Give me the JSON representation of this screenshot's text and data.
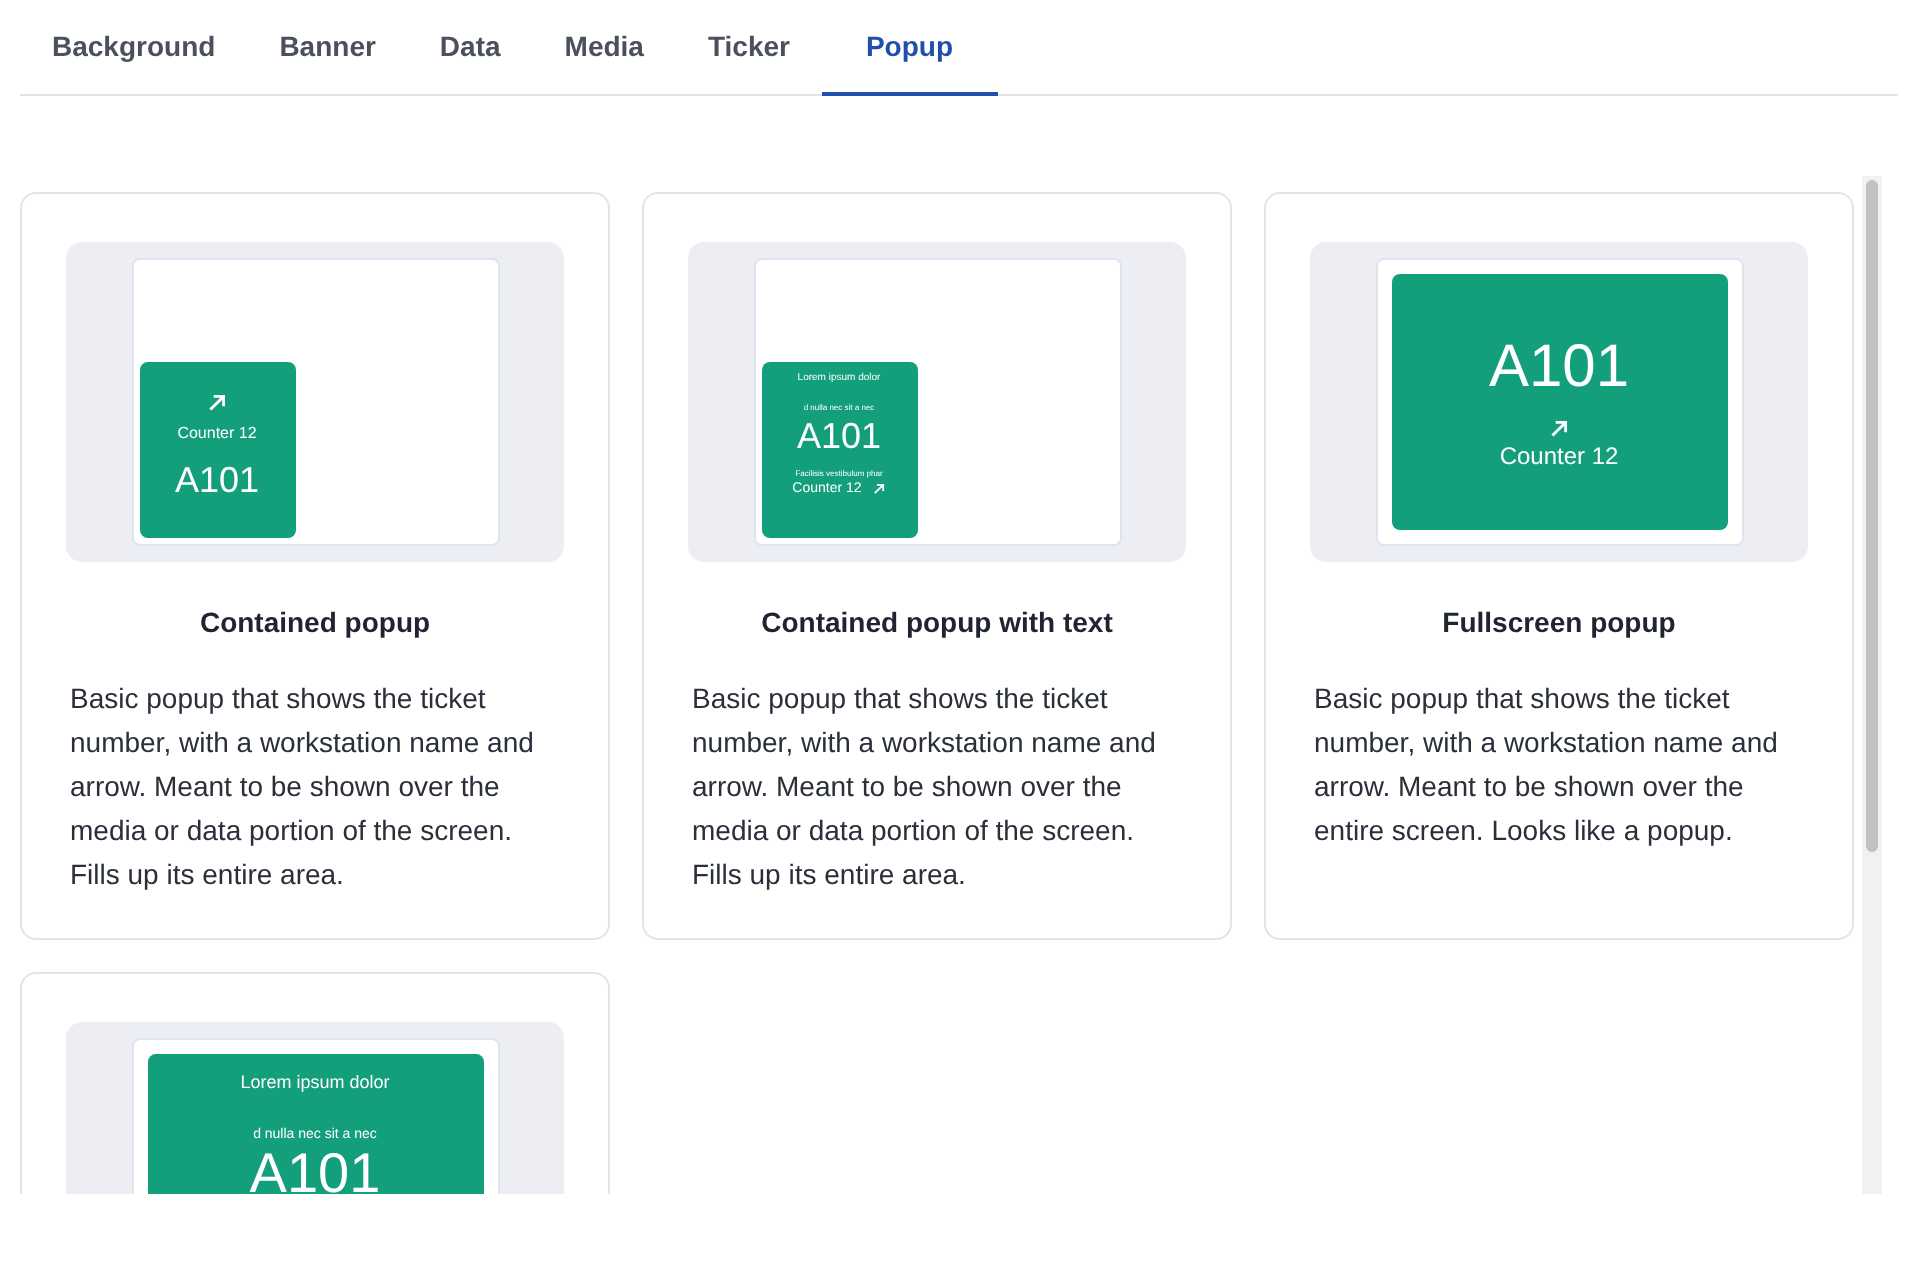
{
  "tabs": [
    {
      "label": "Background",
      "selected": false
    },
    {
      "label": "Banner",
      "selected": false
    },
    {
      "label": "Data",
      "selected": false
    },
    {
      "label": "Media",
      "selected": false
    },
    {
      "label": "Ticker",
      "selected": false
    },
    {
      "label": "Popup",
      "selected": true
    }
  ],
  "cards": [
    {
      "kind": "contained",
      "popup": {
        "counter": "Counter 12",
        "ticket": "A101"
      },
      "title": "Contained popup",
      "description": "Basic popup that shows the ticket number, with a workstation name and arrow. Meant to be shown over the media or data portion of the screen. Fills up its entire area."
    },
    {
      "kind": "contained_text",
      "popup": {
        "header": "Lorem ipsum dolor",
        "subheader": "d nulla nec sit a nec",
        "ticket": "A101",
        "footer": "Facilisis vestibulum phar",
        "counter": "Counter 12"
      },
      "title": "Contained popup with text",
      "description": "Basic popup that shows the ticket number, with a workstation name and arrow. Meant to be shown over the media or data portion of the screen. Fills up its entire area."
    },
    {
      "kind": "fullscreen",
      "popup": {
        "ticket": "A101",
        "counter": "Counter 12"
      },
      "title": "Fullscreen popup",
      "description": "Basic popup that shows the ticket number, with a workstation name and arrow. Meant to be shown over the entire screen. Looks like a popup."
    },
    {
      "kind": "fullscreen_text",
      "popup": {
        "header": "Lorem ipsum dolor",
        "subheader": "d nulla nec sit a nec",
        "ticket": "A101"
      }
    }
  ]
}
